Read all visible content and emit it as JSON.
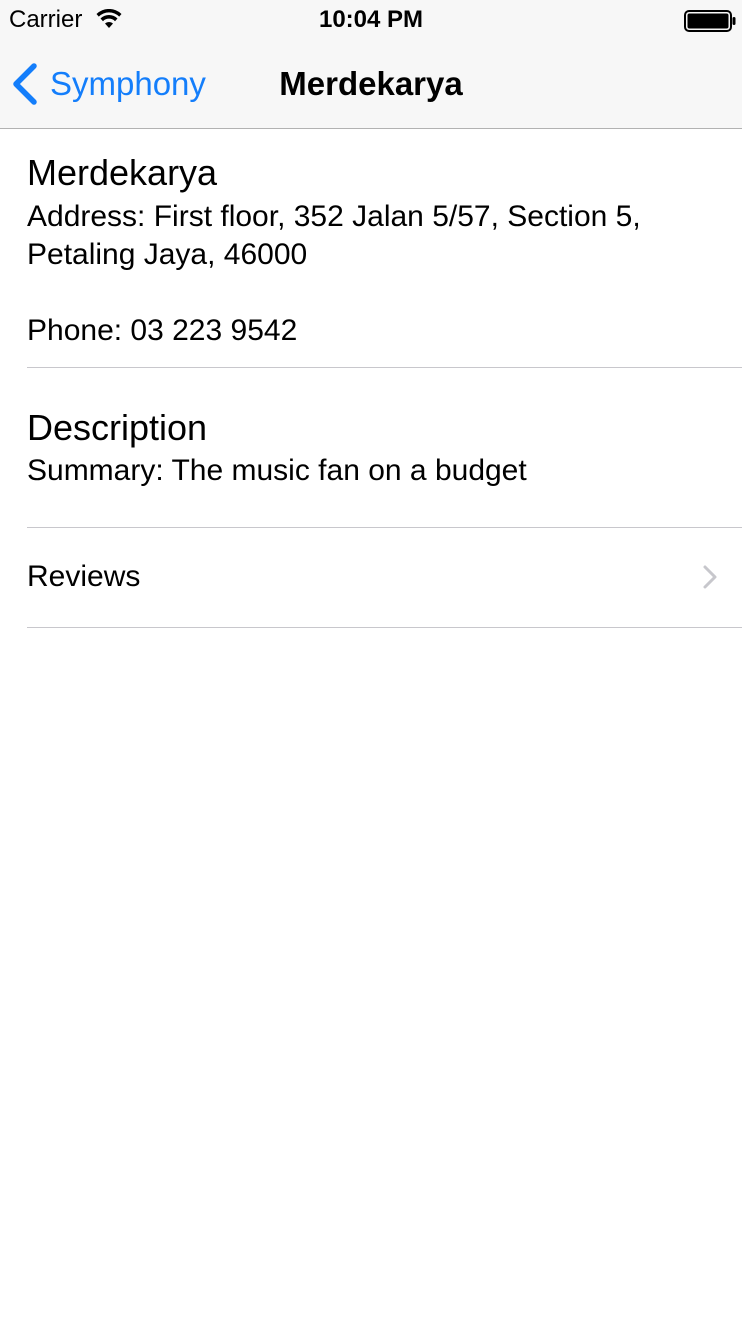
{
  "status_bar": {
    "carrier": "Carrier",
    "time": "10:04 PM",
    "icons": [
      "wifi-icon",
      "battery-icon"
    ]
  },
  "nav_bar": {
    "back_label": "Symphony",
    "back_icon": "chevron-left-icon",
    "title": "Merdekarya",
    "accent_color": "#147efb"
  },
  "info": {
    "name": "Merdekarya",
    "address": "Address: First floor, 352 Jalan 5/57, Section 5, Petaling Jaya, 46000",
    "phone": "Phone: 03 223 9542"
  },
  "description": {
    "heading": "Description",
    "summary": "Summary: The music fan on a budget"
  },
  "reviews": {
    "label": "Reviews",
    "icon": "chevron-right-icon"
  }
}
